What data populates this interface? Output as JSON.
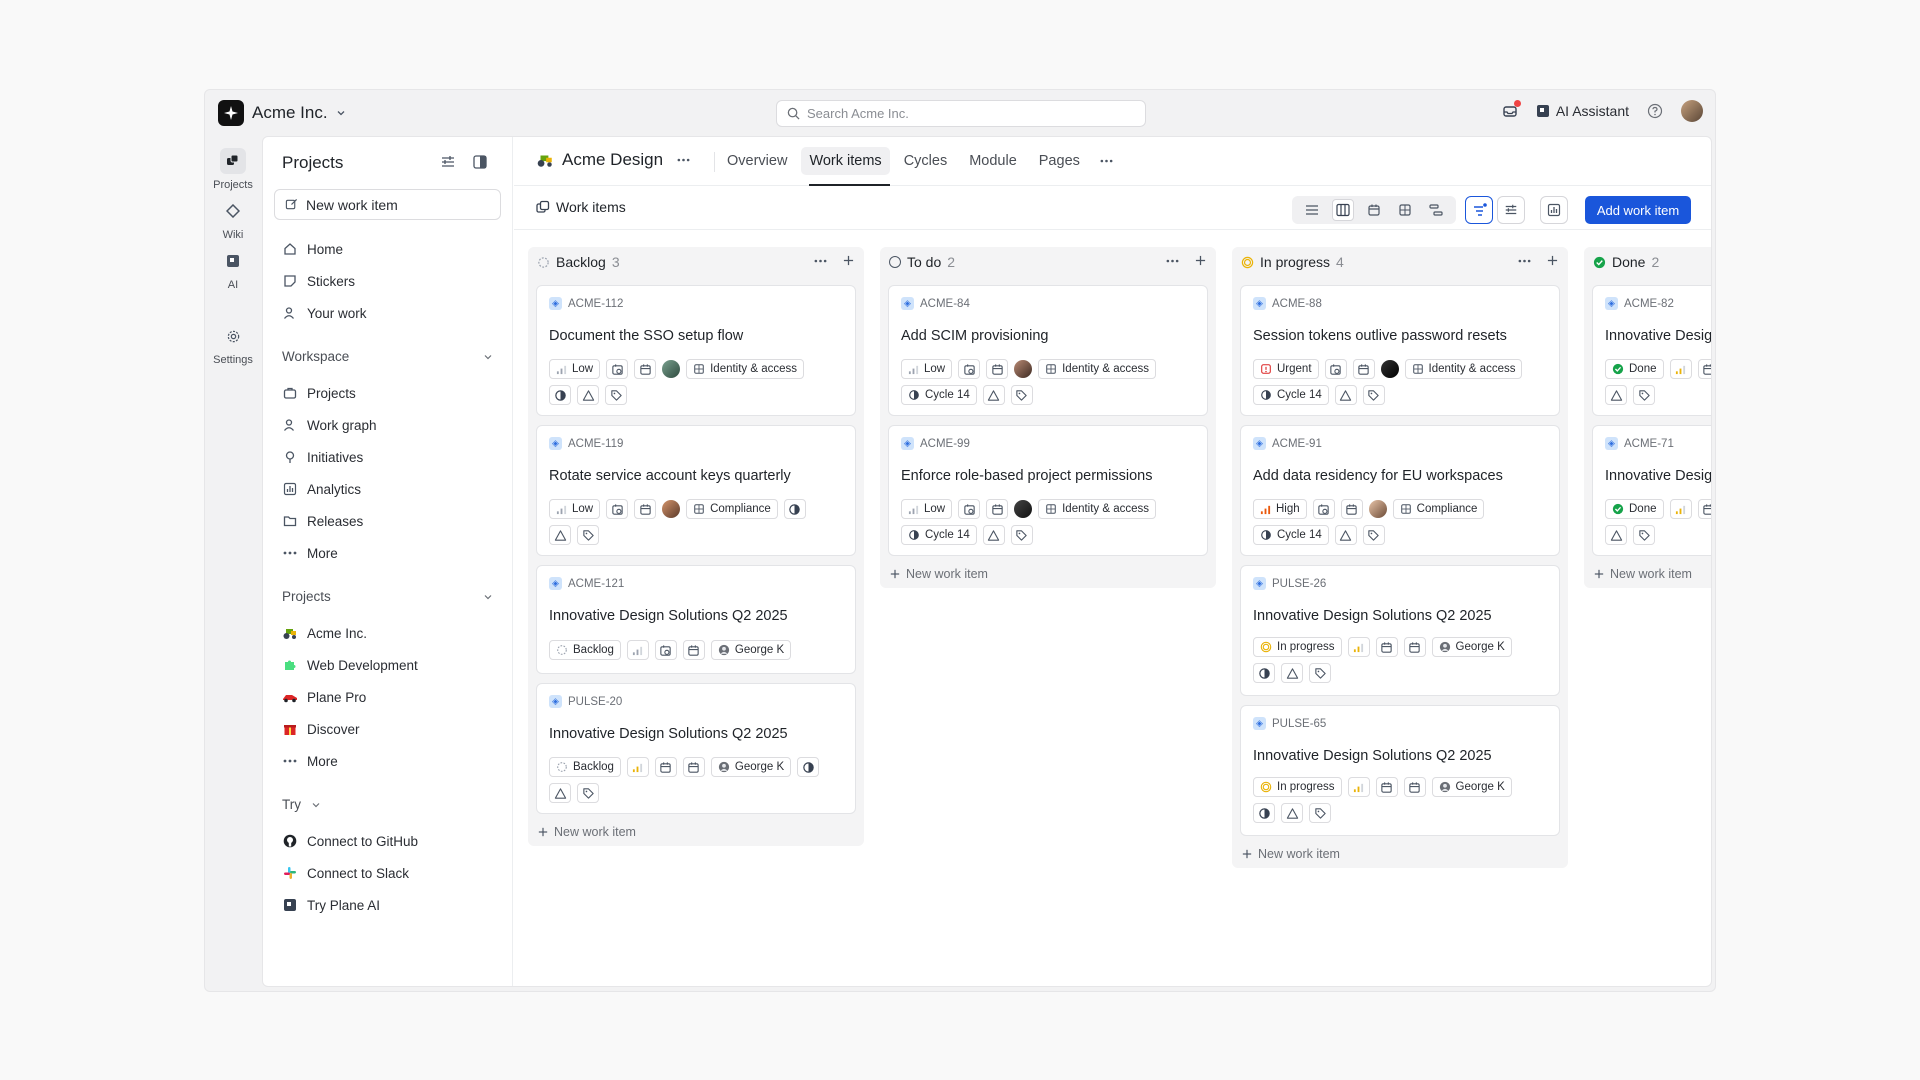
{
  "workspace": {
    "name": "Acme Inc."
  },
  "search": {
    "placeholder": "Search Acme Inc."
  },
  "topbar": {
    "ai_assistant": "AI Assistant"
  },
  "rail": [
    {
      "label": "Projects",
      "icon": "projects-icon"
    },
    {
      "label": "Wiki",
      "icon": "wiki-icon"
    },
    {
      "label": "AI",
      "icon": "ai-icon"
    },
    {
      "label": "Settings",
      "icon": "gear-icon"
    }
  ],
  "sidebar": {
    "title": "Projects",
    "new_work_item": "New work item",
    "main_items": [
      "Home",
      "Stickers",
      "Your work"
    ],
    "workspace_section": "Workspace",
    "workspace_items": [
      "Projects",
      "Work graph",
      "Initiatives",
      "Analytics",
      "Releases",
      "More"
    ],
    "projects_section": "Projects",
    "project_items": [
      "Acme Inc.",
      "Web Development",
      "Plane Pro",
      "Discover",
      "More"
    ],
    "try_section": "Try",
    "try_items": [
      "Connect to GitHub",
      "Connect to Slack",
      "Try Plane AI"
    ]
  },
  "project": {
    "name": "Acme Design",
    "tabs": [
      "Overview",
      "Work items",
      "Cycles",
      "Module",
      "Pages"
    ],
    "active_tab": "Work items"
  },
  "subheader": {
    "title": "Work items",
    "add_button": "Add work item"
  },
  "board": {
    "new_item_label": "New work item",
    "columns": [
      {
        "name": "Backlog",
        "count": "3",
        "state_color": "#9ca3af"
      },
      {
        "name": "To do",
        "count": "2",
        "state_color": "#4b5563"
      },
      {
        "name": "In progress",
        "count": "4",
        "state_color": "#eab308"
      },
      {
        "name": "Done",
        "count": "2",
        "state_color": "#16a34a"
      }
    ],
    "cards": {
      "c1": {
        "id": "ACME-112",
        "title": "Document the SSO setup flow",
        "priority": "Low",
        "label": "Identity & access"
      },
      "c2": {
        "id": "ACME-119",
        "title": "Rotate service account keys quarterly",
        "priority": "Low",
        "label": "Compliance"
      },
      "c3": {
        "id": "ACME-121",
        "title": "Innovative Design Solutions Q2 2025",
        "state": "Backlog",
        "assignee": "George K"
      },
      "c4": {
        "id": "PULSE-20",
        "title": "Innovative Design Solutions Q2 2025",
        "state": "Backlog",
        "assignee": "George K"
      },
      "c5": {
        "id": "ACME-84",
        "title": "Add SCIM provisioning",
        "priority": "Low",
        "label": "Identity & access",
        "cycle": "Cycle 14"
      },
      "c6": {
        "id": "ACME-99",
        "title": "Enforce role-based project permissions",
        "priority": "Low",
        "label": "Identity & access",
        "cycle": "Cycle 14"
      },
      "c7": {
        "id": "ACME-88",
        "title": "Session tokens outlive password resets",
        "priority": "Urgent",
        "label": "Identity & access",
        "cycle": "Cycle 14"
      },
      "c8": {
        "id": "ACME-91",
        "title": "Add data residency for EU workspaces",
        "priority": "High",
        "label": "Compliance",
        "cycle": "Cycle 14"
      },
      "c9": {
        "id": "PULSE-26",
        "title": "Innovative Design Solutions Q2 2025",
        "state": "In progress",
        "assignee": "George K"
      },
      "c10": {
        "id": "PULSE-65",
        "title": "Innovative Design Solutions Q2 2025",
        "state": "In progress",
        "assignee": "George K"
      },
      "c11": {
        "id": "ACME-82",
        "title": "Innovative Desig",
        "state": "Done"
      },
      "c12": {
        "id": "ACME-71",
        "title": "Innovative Desig",
        "state": "Done"
      }
    }
  }
}
